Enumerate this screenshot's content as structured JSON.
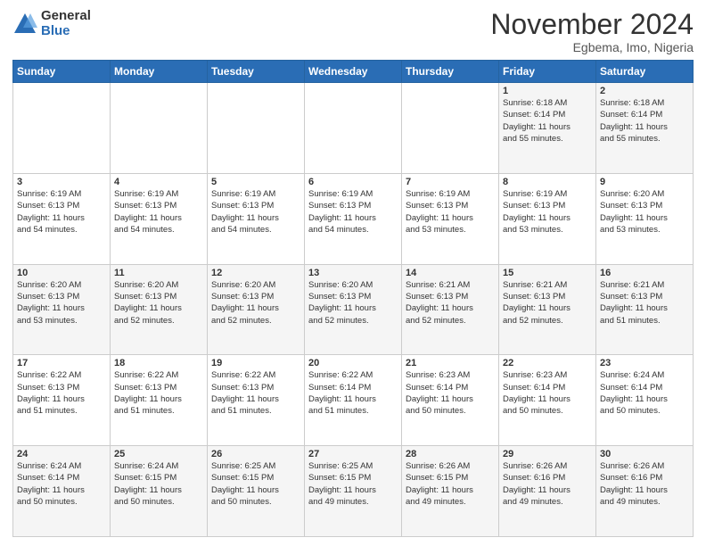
{
  "logo": {
    "general": "General",
    "blue": "Blue"
  },
  "header": {
    "month": "November 2024",
    "location": "Egbema, Imo, Nigeria"
  },
  "weekdays": [
    "Sunday",
    "Monday",
    "Tuesday",
    "Wednesday",
    "Thursday",
    "Friday",
    "Saturday"
  ],
  "weeks": [
    [
      {
        "day": "",
        "info": ""
      },
      {
        "day": "",
        "info": ""
      },
      {
        "day": "",
        "info": ""
      },
      {
        "day": "",
        "info": ""
      },
      {
        "day": "",
        "info": ""
      },
      {
        "day": "1",
        "info": "Sunrise: 6:18 AM\nSunset: 6:14 PM\nDaylight: 11 hours\nand 55 minutes."
      },
      {
        "day": "2",
        "info": "Sunrise: 6:18 AM\nSunset: 6:14 PM\nDaylight: 11 hours\nand 55 minutes."
      }
    ],
    [
      {
        "day": "3",
        "info": "Sunrise: 6:19 AM\nSunset: 6:13 PM\nDaylight: 11 hours\nand 54 minutes."
      },
      {
        "day": "4",
        "info": "Sunrise: 6:19 AM\nSunset: 6:13 PM\nDaylight: 11 hours\nand 54 minutes."
      },
      {
        "day": "5",
        "info": "Sunrise: 6:19 AM\nSunset: 6:13 PM\nDaylight: 11 hours\nand 54 minutes."
      },
      {
        "day": "6",
        "info": "Sunrise: 6:19 AM\nSunset: 6:13 PM\nDaylight: 11 hours\nand 54 minutes."
      },
      {
        "day": "7",
        "info": "Sunrise: 6:19 AM\nSunset: 6:13 PM\nDaylight: 11 hours\nand 53 minutes."
      },
      {
        "day": "8",
        "info": "Sunrise: 6:19 AM\nSunset: 6:13 PM\nDaylight: 11 hours\nand 53 minutes."
      },
      {
        "day": "9",
        "info": "Sunrise: 6:20 AM\nSunset: 6:13 PM\nDaylight: 11 hours\nand 53 minutes."
      }
    ],
    [
      {
        "day": "10",
        "info": "Sunrise: 6:20 AM\nSunset: 6:13 PM\nDaylight: 11 hours\nand 53 minutes."
      },
      {
        "day": "11",
        "info": "Sunrise: 6:20 AM\nSunset: 6:13 PM\nDaylight: 11 hours\nand 52 minutes."
      },
      {
        "day": "12",
        "info": "Sunrise: 6:20 AM\nSunset: 6:13 PM\nDaylight: 11 hours\nand 52 minutes."
      },
      {
        "day": "13",
        "info": "Sunrise: 6:20 AM\nSunset: 6:13 PM\nDaylight: 11 hours\nand 52 minutes."
      },
      {
        "day": "14",
        "info": "Sunrise: 6:21 AM\nSunset: 6:13 PM\nDaylight: 11 hours\nand 52 minutes."
      },
      {
        "day": "15",
        "info": "Sunrise: 6:21 AM\nSunset: 6:13 PM\nDaylight: 11 hours\nand 52 minutes."
      },
      {
        "day": "16",
        "info": "Sunrise: 6:21 AM\nSunset: 6:13 PM\nDaylight: 11 hours\nand 51 minutes."
      }
    ],
    [
      {
        "day": "17",
        "info": "Sunrise: 6:22 AM\nSunset: 6:13 PM\nDaylight: 11 hours\nand 51 minutes."
      },
      {
        "day": "18",
        "info": "Sunrise: 6:22 AM\nSunset: 6:13 PM\nDaylight: 11 hours\nand 51 minutes."
      },
      {
        "day": "19",
        "info": "Sunrise: 6:22 AM\nSunset: 6:13 PM\nDaylight: 11 hours\nand 51 minutes."
      },
      {
        "day": "20",
        "info": "Sunrise: 6:22 AM\nSunset: 6:14 PM\nDaylight: 11 hours\nand 51 minutes."
      },
      {
        "day": "21",
        "info": "Sunrise: 6:23 AM\nSunset: 6:14 PM\nDaylight: 11 hours\nand 50 minutes."
      },
      {
        "day": "22",
        "info": "Sunrise: 6:23 AM\nSunset: 6:14 PM\nDaylight: 11 hours\nand 50 minutes."
      },
      {
        "day": "23",
        "info": "Sunrise: 6:24 AM\nSunset: 6:14 PM\nDaylight: 11 hours\nand 50 minutes."
      }
    ],
    [
      {
        "day": "24",
        "info": "Sunrise: 6:24 AM\nSunset: 6:14 PM\nDaylight: 11 hours\nand 50 minutes."
      },
      {
        "day": "25",
        "info": "Sunrise: 6:24 AM\nSunset: 6:15 PM\nDaylight: 11 hours\nand 50 minutes."
      },
      {
        "day": "26",
        "info": "Sunrise: 6:25 AM\nSunset: 6:15 PM\nDaylight: 11 hours\nand 50 minutes."
      },
      {
        "day": "27",
        "info": "Sunrise: 6:25 AM\nSunset: 6:15 PM\nDaylight: 11 hours\nand 49 minutes."
      },
      {
        "day": "28",
        "info": "Sunrise: 6:26 AM\nSunset: 6:15 PM\nDaylight: 11 hours\nand 49 minutes."
      },
      {
        "day": "29",
        "info": "Sunrise: 6:26 AM\nSunset: 6:16 PM\nDaylight: 11 hours\nand 49 minutes."
      },
      {
        "day": "30",
        "info": "Sunrise: 6:26 AM\nSunset: 6:16 PM\nDaylight: 11 hours\nand 49 minutes."
      }
    ]
  ]
}
